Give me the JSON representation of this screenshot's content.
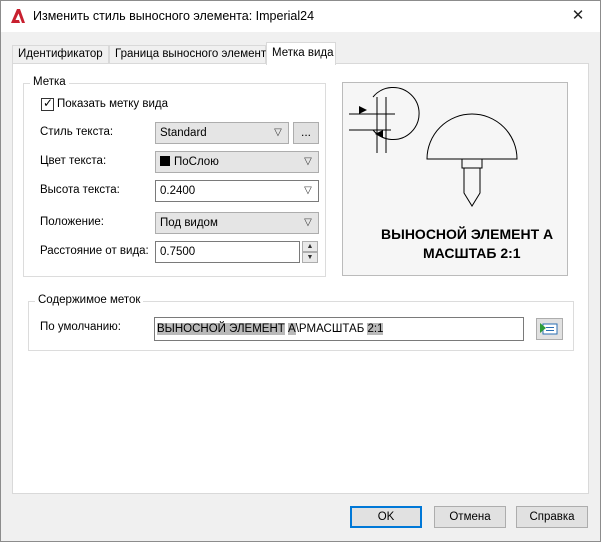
{
  "window": {
    "title": "Изменить стиль выносного элемента: Imperial24",
    "close_glyph": "✕",
    "app_icon": "autocad-a-icon"
  },
  "tabs": [
    {
      "label": "Идентификатор",
      "active": false
    },
    {
      "label": "Граница выносного элемента",
      "active": false
    },
    {
      "label": "Метка вида",
      "active": true
    }
  ],
  "label_group": {
    "title": "Метка",
    "show_label_checkbox": {
      "label": "Показать метку вида",
      "checked": true
    },
    "text_style": {
      "label": "Стиль текста:",
      "value": "Standard",
      "browse_label": "..."
    },
    "text_color": {
      "label": "Цвет текста:",
      "value": "ПоСлою",
      "swatch_color": "#000000"
    },
    "text_height": {
      "label": "Высота текста:",
      "value": "0.2400"
    },
    "position": {
      "label": "Положение:",
      "value": "Под видом"
    },
    "distance": {
      "label": "Расстояние от вида:",
      "value": "0.7500"
    }
  },
  "preview": {
    "line1": "ВЫНОСНОЙ ЭЛЕМЕНТ A",
    "line2": "МАСШТАБ 2:1"
  },
  "contents_group": {
    "title": "Содержимое меток",
    "default_label": "По умолчанию:",
    "value_parts": [
      {
        "text": "ВЫНОСНОЙ ЭЛЕМЕНТ",
        "field": true
      },
      {
        "text": " ",
        "field": false
      },
      {
        "text": "A",
        "field": true
      },
      {
        "text": "\\PМАСШТАБ ",
        "field": false
      },
      {
        "text": "2:1",
        "field": true
      }
    ],
    "insert_field_icon": "insert-field-icon"
  },
  "buttons": {
    "ok": "OK",
    "cancel": "Отмена",
    "help": "Справка"
  }
}
